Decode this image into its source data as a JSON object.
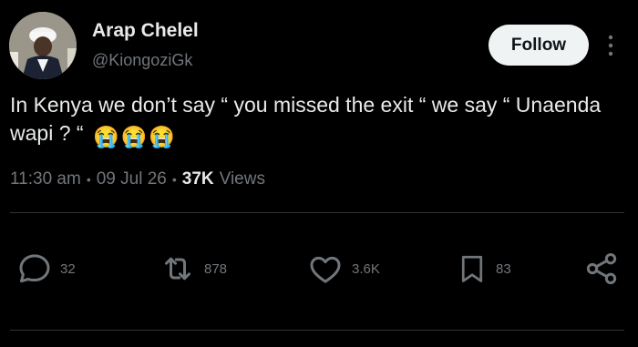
{
  "author": {
    "name": "Arap Chelel",
    "handle": "@KiongoziGk"
  },
  "header": {
    "follow_label": "Follow"
  },
  "tweet": {
    "text": "In Kenya we don’t say “ you missed the exit “ we say “ Unaenda wapi ? “",
    "emojis": [
      "😭",
      "😭",
      "😭"
    ]
  },
  "meta": {
    "time": "11:30 am",
    "date": "09 Jul 26",
    "views_count": "37K",
    "views_label": "Views"
  },
  "actions": {
    "replies": "32",
    "reposts": "878",
    "likes": "3.6K",
    "bookmarks": "83"
  },
  "icons": [
    "avatar-photo",
    "more-icon",
    "reply-icon",
    "repost-icon",
    "like-icon",
    "bookmark-icon",
    "share-icon"
  ],
  "colors": {
    "background": "#000000",
    "text": "#e7e9ea",
    "muted": "#71767b",
    "button_bg": "#eff3f4",
    "divider": "#2f3336"
  }
}
